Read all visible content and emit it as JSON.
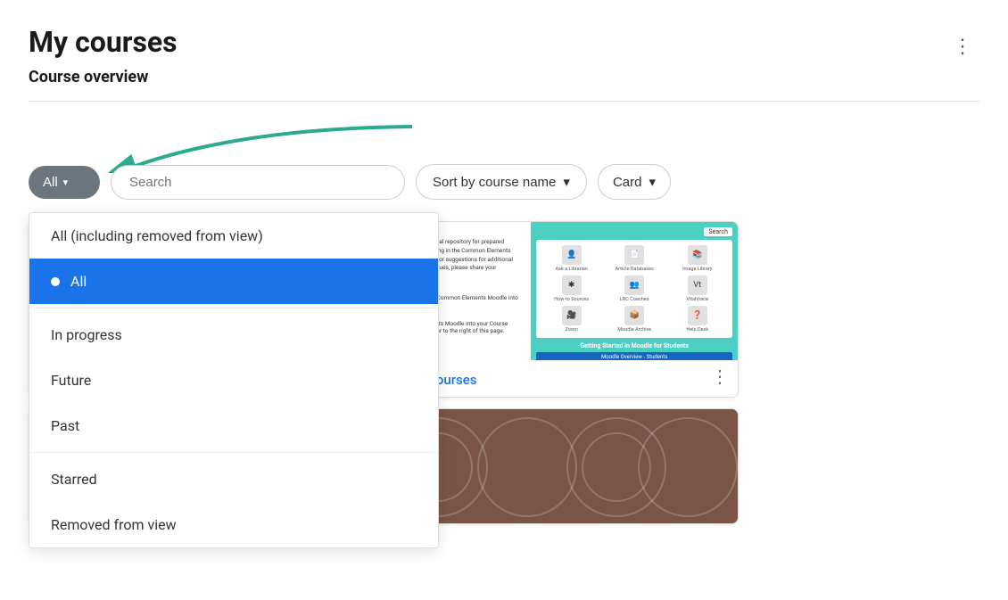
{
  "page": {
    "title": "My courses",
    "section_title": "Course overview",
    "three_dots_label": "⋮"
  },
  "toolbar": {
    "all_button_label": "All",
    "search_placeholder": "Search",
    "sort_label": "Sort by course name",
    "card_label": "Card"
  },
  "dropdown": {
    "items": [
      {
        "id": "all-including-removed",
        "label": "All (including removed from view)",
        "active": false,
        "divider_before": false
      },
      {
        "id": "all",
        "label": "All",
        "active": true,
        "divider_before": false
      },
      {
        "id": "in-progress",
        "label": "In progress",
        "active": false,
        "divider_before": true
      },
      {
        "id": "future",
        "label": "Future",
        "active": false,
        "divider_before": false
      },
      {
        "id": "past",
        "label": "Past",
        "active": false,
        "divider_before": false
      },
      {
        "id": "starred",
        "label": "Starred",
        "active": false,
        "divider_before": true
      },
      {
        "id": "removed-from-view",
        "label": "Removed from view",
        "active": false,
        "divider_before": false
      }
    ]
  },
  "courses": [
    {
      "id": "course-1",
      "title": "",
      "image_type": "blue-gear",
      "visible": true
    },
    {
      "id": "course-common-elements",
      "title": "Common Elements for Courses",
      "image_type": "teal-library",
      "visible": true
    },
    {
      "id": "course-3",
      "title": "",
      "image_type": "orange-letter",
      "visible": true
    },
    {
      "id": "course-4",
      "title": "",
      "image_type": "brown-circles",
      "visible": true
    }
  ],
  "icons": {
    "three_dots": "⋮",
    "chevron_down": "▾",
    "gear": "⚙"
  }
}
